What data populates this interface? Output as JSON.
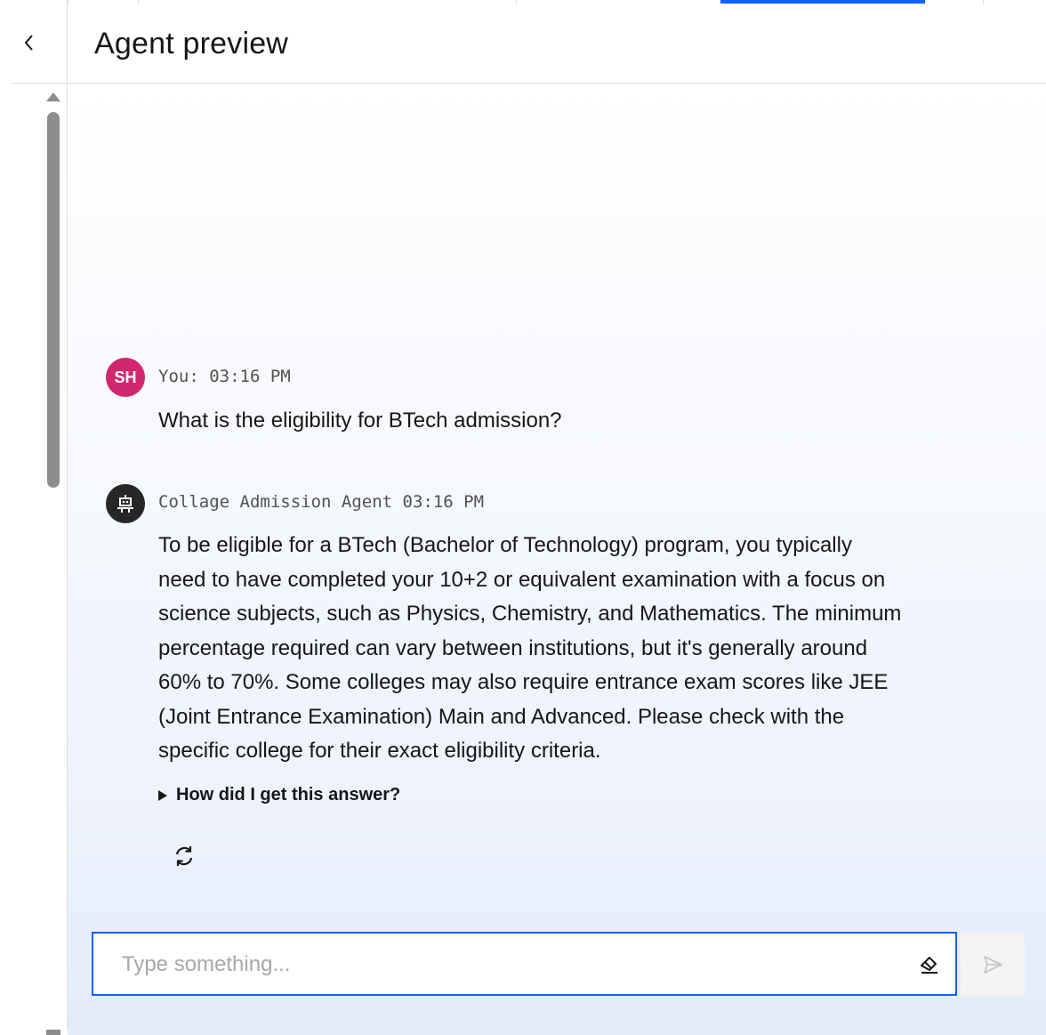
{
  "header": {
    "title": "Agent preview",
    "back_icon": "chevron-left-icon"
  },
  "conversation": {
    "user": {
      "avatar_initials": "SH",
      "avatar_color": "#d12771",
      "meta": "You: 03:16 PM",
      "text": "What is the eligibility for BTech admission?"
    },
    "agent": {
      "avatar_icon": "robot-icon",
      "meta": "Collage Admission Agent 03:16 PM",
      "lines": [
        "To be eligible for a BTech (Bachelor of Technology) program, you typically",
        "need to have completed your 10+2 or equivalent examination with a focus on",
        "science subjects, such as Physics, Chemistry, and Mathematics. The minimum",
        "percentage required can vary between institutions, but it's generally around",
        "60% to 70%. Some colleges may also require entrance exam scores like JEE",
        "(Joint Entrance Examination) Main and Advanced. Please check with the",
        "specific college for their exact eligibility criteria."
      ],
      "explain_label": "How did I get this answer?",
      "regenerate_icon": "refresh-icon"
    }
  },
  "input": {
    "placeholder": "Type something...",
    "value": "",
    "clear_icon": "eraser-icon",
    "send_icon": "send-icon"
  },
  "colors": {
    "accent": "#0f62fe",
    "user_avatar": "#d12771",
    "agent_avatar": "#262626"
  }
}
